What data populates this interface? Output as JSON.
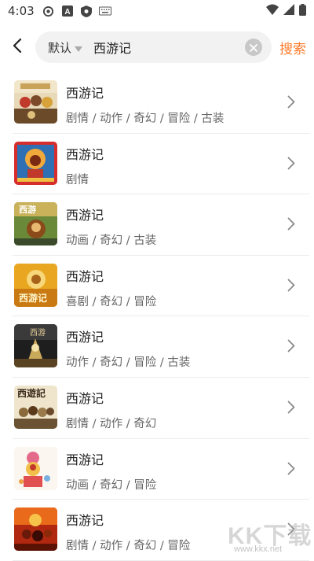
{
  "status_bar": {
    "time": "4:03",
    "icons": [
      "settings-gear-icon",
      "a-app-icon",
      "shield-app-icon",
      "keyboard-icon"
    ],
    "right_icons": [
      "wifi-icon",
      "signal-icon",
      "battery-icon"
    ]
  },
  "search": {
    "filter_label": "默认",
    "query": "西游记",
    "submit_label": "搜索"
  },
  "colors": {
    "accent": "#ff7a29",
    "search_bg": "#f2f2f2"
  },
  "results": [
    {
      "title": "西游记",
      "tags": "剧情 / 动作 / 奇幻 / 冒险 / 古装"
    },
    {
      "title": "西游记",
      "tags": "剧情"
    },
    {
      "title": "西游记",
      "tags": "动画 / 奇幻 / 古装"
    },
    {
      "title": "西游记",
      "tags": "喜剧 / 奇幻 / 冒险"
    },
    {
      "title": "西游记",
      "tags": "动作 / 奇幻 / 冒险 / 古装"
    },
    {
      "title": "西游记",
      "tags": "剧情 / 动作 / 奇幻"
    },
    {
      "title": "西游记",
      "tags": "动画 / 奇幻 / 冒险"
    },
    {
      "title": "西游记",
      "tags": "剧情 / 动作 / 奇幻 / 冒险"
    }
  ],
  "watermark": {
    "text": "KK下载",
    "url": "www.kkx.net"
  }
}
